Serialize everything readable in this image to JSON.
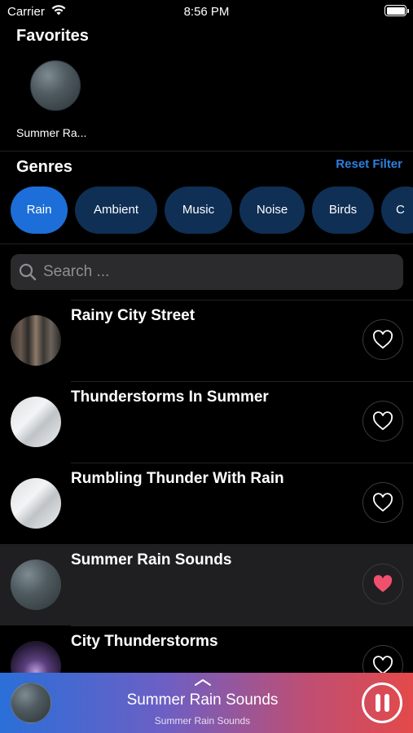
{
  "status_bar": {
    "carrier": "Carrier",
    "time": "8:56 PM"
  },
  "favorites": {
    "title": "Favorites",
    "items": [
      {
        "label": "Summer Ra..."
      }
    ]
  },
  "genres": {
    "title": "Genres",
    "reset_label": "Reset Filter",
    "chips": [
      {
        "label": "Rain",
        "active": true
      },
      {
        "label": "Ambient",
        "active": false
      },
      {
        "label": "Music",
        "active": false
      },
      {
        "label": "Noise",
        "active": false
      },
      {
        "label": "Birds",
        "active": false
      },
      {
        "label": "C",
        "active": false
      }
    ]
  },
  "search": {
    "placeholder": "Search ...",
    "value": ""
  },
  "tracks": [
    {
      "title": "Rainy City Street",
      "artwork": "city-street-photo",
      "favorited": false,
      "selected": false
    },
    {
      "title": "Thunderstorms In Summer",
      "artwork": "window-photo",
      "favorited": false,
      "selected": false
    },
    {
      "title": "Rumbling Thunder With Rain",
      "artwork": "window-photo",
      "favorited": false,
      "selected": false
    },
    {
      "title": "Summer Rain Sounds",
      "artwork": "rain-drops-photo",
      "favorited": true,
      "selected": true
    },
    {
      "title": "City Thunderstorms",
      "artwork": "lightning-photo",
      "favorited": false,
      "selected": false
    }
  ],
  "now_playing": {
    "title": "Summer Rain Sounds",
    "subtitle": "Summer Rain Sounds",
    "state": "playing"
  },
  "colors": {
    "accent": "#2f7fe0",
    "chip_active": "#1d6ed8",
    "chip_inactive": "#0f2f55",
    "heart_active": "#f0506e",
    "player_gradient_start": "#2a6fd8",
    "player_gradient_end": "#e34a4a"
  }
}
